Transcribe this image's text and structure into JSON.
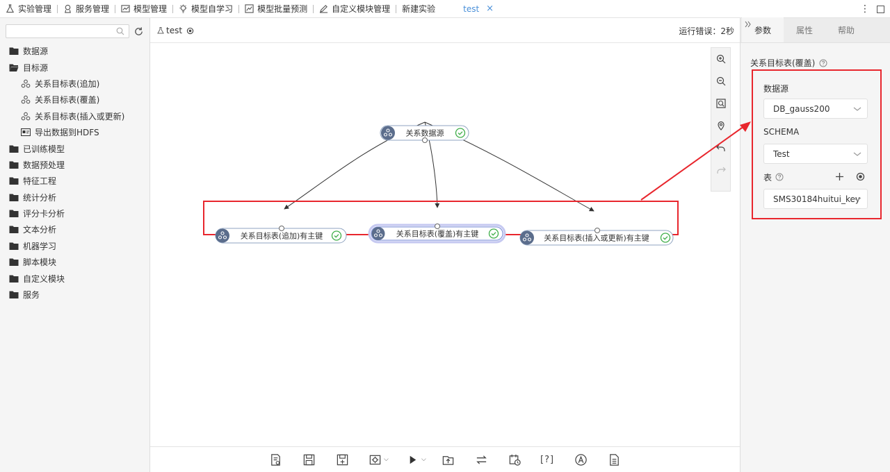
{
  "nav": {
    "items": [
      {
        "label": "实验管理",
        "icon": "flask-icon"
      },
      {
        "label": "服务管理",
        "icon": "service-icon"
      },
      {
        "label": "模型管理",
        "icon": "chart-icon"
      },
      {
        "label": "模型自学习",
        "icon": "bulb-icon"
      },
      {
        "label": "模型批量预测",
        "icon": "trend-icon"
      },
      {
        "label": "自定义模块管理",
        "icon": "edit-icon"
      },
      {
        "label": "新建实验",
        "icon": ""
      }
    ],
    "active_tab": "test",
    "close_glyph": "×"
  },
  "sidebar": {
    "search": {
      "placeholder": "",
      "value": ""
    },
    "tree": [
      {
        "label": "数据源",
        "type": "folder"
      },
      {
        "label": "目标源",
        "type": "folder-open"
      },
      {
        "label": "关系目标表(追加)",
        "type": "node"
      },
      {
        "label": "关系目标表(覆盖)",
        "type": "node"
      },
      {
        "label": "关系目标表(插入或更新)",
        "type": "node"
      },
      {
        "label": "导出数据到HDFS",
        "type": "hdfs"
      },
      {
        "label": "已训练模型",
        "type": "folder"
      },
      {
        "label": "数据预处理",
        "type": "folder"
      },
      {
        "label": "特征工程",
        "type": "folder"
      },
      {
        "label": "统计分析",
        "type": "folder"
      },
      {
        "label": "评分卡分析",
        "type": "folder"
      },
      {
        "label": "文本分析",
        "type": "folder"
      },
      {
        "label": "机器学习",
        "type": "folder"
      },
      {
        "label": "脚本模块",
        "type": "folder"
      },
      {
        "label": "自定义模块",
        "type": "folder"
      },
      {
        "label": "服务",
        "type": "folder"
      }
    ]
  },
  "canvas": {
    "experiment_name": "test",
    "run_error": "运行错误：2秒",
    "nodes": [
      {
        "label": "关系数据源"
      },
      {
        "label": "关系目标表(追加)有主键"
      },
      {
        "label": "关系目标表(覆盖)有主键"
      },
      {
        "label": "关系目标表(插入或更新)有主键"
      }
    ],
    "help_bracket": "[?]"
  },
  "right_panel": {
    "tabs": [
      "参数",
      "属性",
      "帮助"
    ],
    "component_title": "关系目标表(覆盖)",
    "datasource_label": "数据源",
    "datasource_value": "DB_gauss200",
    "schema_label": "SCHEMA",
    "schema_value": "Test",
    "table_label": "表",
    "table_value": "SMS30184huitui_key"
  },
  "colors": {
    "accent": "#4a90d9",
    "highlight": "#e8262d",
    "node_icon": "#5b6d8c",
    "success": "#3fae49"
  }
}
